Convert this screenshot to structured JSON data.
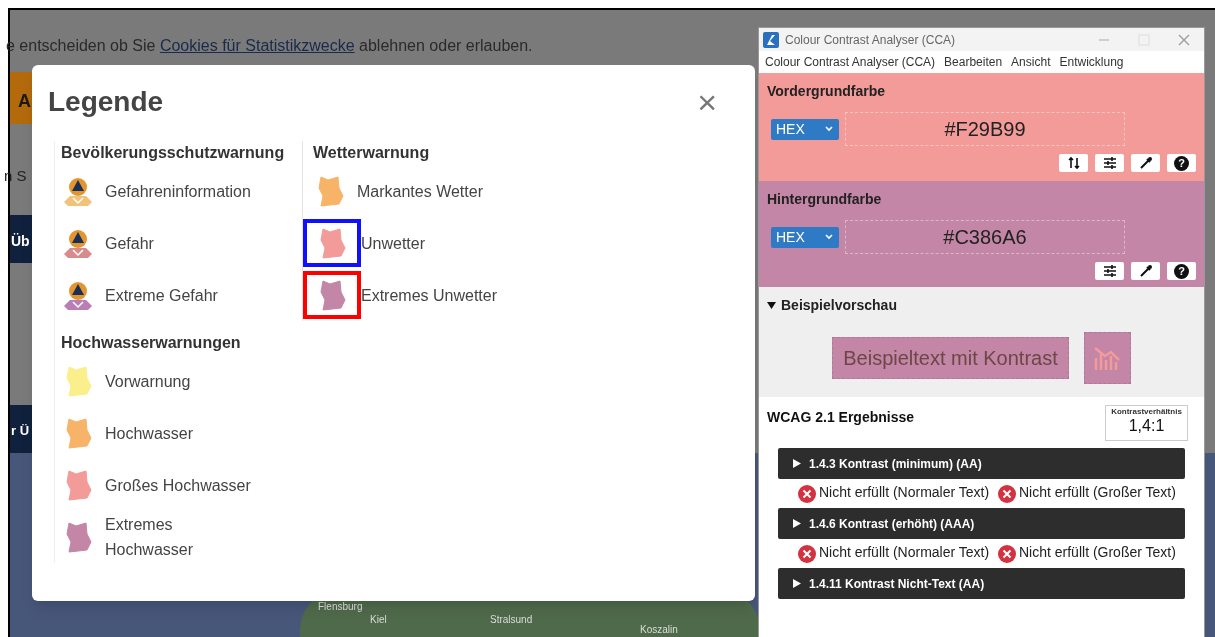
{
  "background_page": {
    "notice_before": "e entscheiden ob Sie",
    "notice_link": "Cookies für Statistikzwecke",
    "notice_after": "ablehnen oder erlauben.",
    "fragments": [
      "A",
      "n S",
      "Üb",
      "r Ü"
    ],
    "map_labels": [
      "Flensburg",
      "Kiel",
      "Stralsund",
      "Koszalin"
    ]
  },
  "legend": {
    "title": "Legende",
    "close": "×",
    "columns": [
      {
        "sections": [
          {
            "heading": "Bevölkerungsschutzwarnung",
            "items": [
              {
                "kind": "person",
                "label": "Gefahreninformation",
                "color": "#f3c27a"
              },
              {
                "kind": "person",
                "label": "Gefahr",
                "color": "#d98a8c"
              },
              {
                "kind": "person",
                "label": "Extreme Gefahr",
                "color": "#bb7db6"
              }
            ]
          },
          {
            "heading": "Hochwasserwarnungen",
            "items": [
              {
                "kind": "area",
                "label": "Vorwarnung",
                "color": "#fbef8c"
              },
              {
                "kind": "area",
                "label": "Hochwasser",
                "color": "#f7b469"
              },
              {
                "kind": "area",
                "label": "Großes Hochwasser",
                "color": "#f29b99"
              },
              {
                "kind": "area",
                "label": "Extremes Hochwasser",
                "color": "#c386a6"
              }
            ]
          }
        ]
      },
      {
        "sections": [
          {
            "heading": "Wetterwarnung",
            "items": [
              {
                "kind": "area",
                "label": "Markantes Wetter",
                "color": "#f7b469"
              },
              {
                "kind": "area",
                "label": "Unwetter",
                "color": "#f29b99",
                "highlight": {
                  "color": "#1010ff"
                }
              },
              {
                "kind": "area",
                "label": "Extremes Unwetter",
                "color": "#c386a6",
                "highlight": {
                  "color": "#ff0000"
                }
              }
            ]
          }
        ]
      }
    ]
  },
  "cca": {
    "window": {
      "title": "Colour Contrast Analyser (CCA)"
    },
    "menu": [
      "Colour Contrast Analyser (CCA)",
      "Bearbeiten",
      "Ansicht",
      "Entwicklung"
    ],
    "colors": [
      {
        "heading": "Vordergrundfarbe",
        "format": "HEX",
        "value": "#F29B99",
        "color": "#f29b99",
        "tools": [
          {
            "kind": "swap"
          },
          {
            "kind": "sliders"
          },
          {
            "kind": "picker"
          },
          {
            "kind": "help",
            "label": "?"
          }
        ]
      },
      {
        "heading": "Hintergrundfarbe",
        "format": "HEX",
        "value": "#C386A6",
        "color": "#c386a6",
        "tools": [
          {
            "kind": "sliders"
          },
          {
            "kind": "picker"
          },
          {
            "kind": "help",
            "label": "?"
          }
        ]
      }
    ],
    "preview": {
      "heading": "Beispielvorschau",
      "expanded": true,
      "sample": "Beispieltext mit Kontrast"
    },
    "results": {
      "heading": "WCAG 2.1 Ergebnisse",
      "ratio_label": "Kontrastverhältnis",
      "ratio": "1,4:1",
      "criteria": [
        {
          "title": "1.4.3 Kontrast (minimum) (AA)",
          "expanded": false,
          "outcomes": [
            "Nicht erfüllt (Normaler Text)",
            "Nicht erfüllt (Großer Text)"
          ]
        },
        {
          "title": "1.4.6 Kontrast (erhöht) (AAA)",
          "expanded": false,
          "outcomes": [
            "Nicht erfüllt (Normaler Text)",
            "Nicht erfüllt (Großer Text)"
          ]
        },
        {
          "title": "1.4.11 Kontrast Nicht-Text (AA)",
          "expanded": false
        }
      ]
    }
  }
}
